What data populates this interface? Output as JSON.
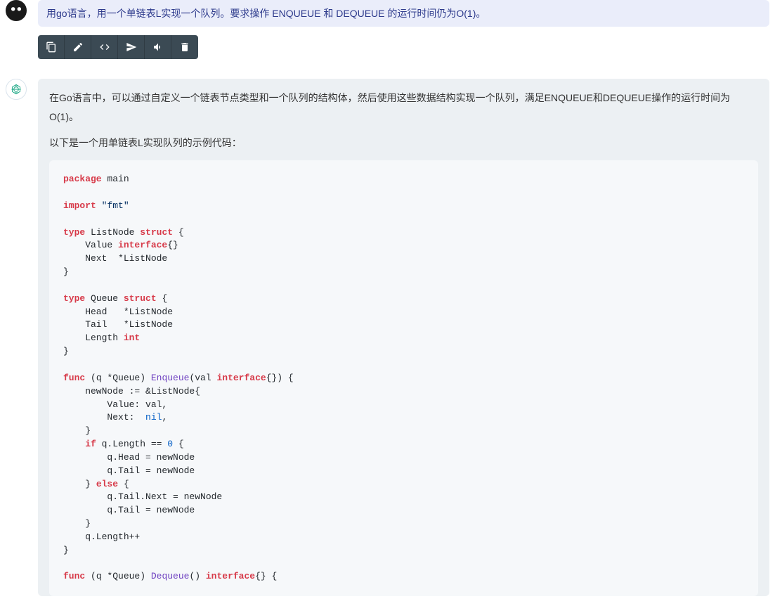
{
  "user_message": "用go语言，用一个单链表L实现一个队列。要求操作 ENQUEUE 和 DEQUEUE 的运行时间仍为O(1)。",
  "assistant": {
    "para1": "在Go语言中，可以通过自定义一个链表节点类型和一个队列的结构体，然后使用这些数据结构实现一个队列，满足ENQUEUE和DEQUEUE操作的运行时间为O(1)。",
    "para2": "以下是一个用单链表L实现队列的示例代码："
  },
  "toolbar": {
    "copy": "copy",
    "edit": "edit",
    "code": "code",
    "share": "share",
    "volume": "volume",
    "delete": "delete"
  },
  "code": {
    "l1a": "package",
    "l1b": " main",
    "l2a": "import",
    "l2b": " ",
    "l2c": "\"fmt\"",
    "l3a": "type",
    "l3b": " ListNode ",
    "l3c": "struct",
    "l3d": " {",
    "l4a": "    Value ",
    "l4b": "interface",
    "l4c": "{}",
    "l5a": "    Next  *ListNode",
    "l6a": "}",
    "l7a": "type",
    "l7b": " Queue ",
    "l7c": "struct",
    "l7d": " {",
    "l8a": "    Head   *ListNode",
    "l9a": "    Tail   *ListNode",
    "l10a": "    Length ",
    "l10b": "int",
    "l11a": "}",
    "l12a": "func",
    "l12b": " (q *Queue) ",
    "l12c": "Enqueue",
    "l12d": "(val ",
    "l12e": "interface",
    "l12f": "{}) {",
    "l13a": "    newNode := &ListNode{",
    "l14a": "        Value: val,",
    "l15a": "        Next:  ",
    "l15b": "nil",
    "l15c": ",",
    "l16a": "    }",
    "l17a": "    ",
    "l17b": "if",
    "l17c": " q.Length == ",
    "l17d": "0",
    "l17e": " {",
    "l18a": "        q.Head = newNode",
    "l19a": "        q.Tail = newNode",
    "l20a": "    } ",
    "l20b": "else",
    "l20c": " {",
    "l21a": "        q.Tail.Next = newNode",
    "l22a": "        q.Tail = newNode",
    "l23a": "    }",
    "l24a": "    q.Length++",
    "l25a": "}",
    "l26a": "func",
    "l26b": " (q *Queue) ",
    "l26c": "Dequeue",
    "l26d": "() ",
    "l26e": "interface",
    "l26f": "{} {"
  }
}
